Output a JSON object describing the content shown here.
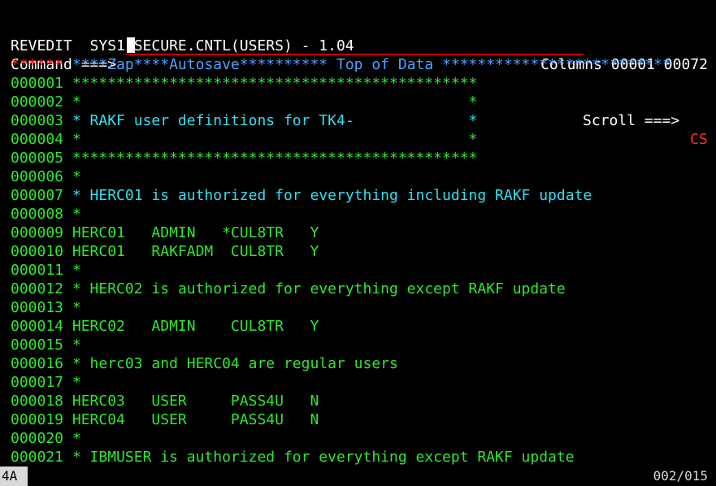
{
  "header": {
    "title": "REVEDIT  SYS1.SECURE.CNTL(USERS) - 1.04",
    "columns": "Columns 00001 00072"
  },
  "command": {
    "label": "Command ===>",
    "value": "",
    "scroll_label": "Scroll ===>",
    "scroll_value": "CS"
  },
  "top_of_data": {
    "marker": "******",
    "banner": " ****Zap****Autosave********** Top of Data **************************"
  },
  "lines": [
    {
      "num": "000001",
      "text": " **********************************************",
      "style": "green"
    },
    {
      "num": "000002",
      "text": " *                                            *",
      "style": "green"
    },
    {
      "num": "000003",
      "text": " * RAKF user definitions for TK4-             *",
      "style": "cyan"
    },
    {
      "num": "000004",
      "text": " *                                            *",
      "style": "green"
    },
    {
      "num": "000005",
      "text": " **********************************************",
      "style": "green"
    },
    {
      "num": "000006",
      "text": " *",
      "style": "green"
    },
    {
      "num": "000007",
      "text": " * HERC01 is authorized for everything including RAKF update",
      "style": "cyan"
    },
    {
      "num": "000008",
      "text": " *",
      "style": "green"
    },
    {
      "num": "000009",
      "text": " HERC01   ADMIN   *CUL8TR   Y",
      "style": "green"
    },
    {
      "num": "000010",
      "text": " HERC01   RAKFADM  CUL8TR   Y",
      "style": "green"
    },
    {
      "num": "000011",
      "text": " *",
      "style": "green"
    },
    {
      "num": "000012",
      "text": " * HERC02 is authorized for everything except RAKF update",
      "style": "green"
    },
    {
      "num": "000013",
      "text": " *",
      "style": "green"
    },
    {
      "num": "000014",
      "text": " HERC02   ADMIN    CUL8TR   Y",
      "style": "green"
    },
    {
      "num": "000015",
      "text": " *",
      "style": "green"
    },
    {
      "num": "000016",
      "text": " * herc03 and HERC04 are regular users",
      "style": "green"
    },
    {
      "num": "000017",
      "text": " *",
      "style": "green"
    },
    {
      "num": "000018",
      "text": " HERC03   USER     PASS4U   N",
      "style": "green"
    },
    {
      "num": "000019",
      "text": " HERC04   USER     PASS4U   N",
      "style": "green"
    },
    {
      "num": "000020",
      "text": " *",
      "style": "green"
    },
    {
      "num": "000021",
      "text": " * IBMUSER is authorized for everything except RAKF update",
      "style": "green"
    }
  ],
  "status": {
    "session": "4A",
    "cursor_position": "002/015"
  },
  "colors": {
    "background": "#000000",
    "line_number": "#2ee82e",
    "comment_cyan": "#2fe0f0",
    "banner_blue": "#4ea1ff",
    "marker_red": "#ff2020"
  }
}
